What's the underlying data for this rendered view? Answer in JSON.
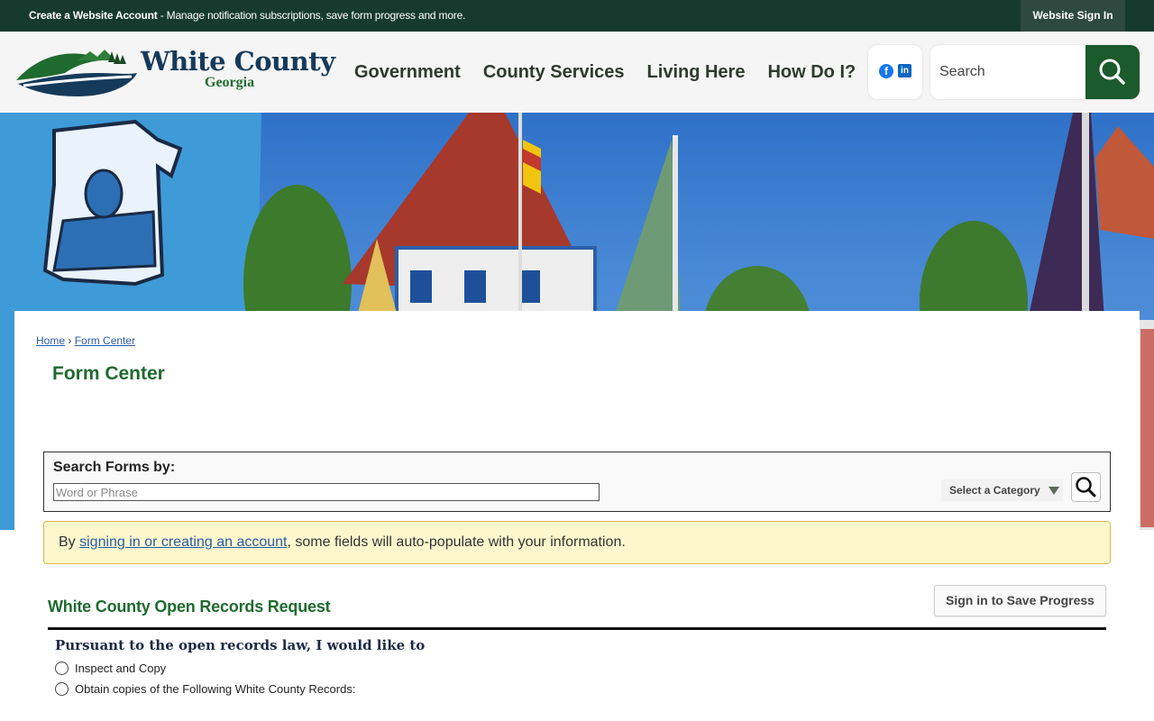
{
  "topbar": {
    "account_strong": "Create a Website Account",
    "account_rest": " - Manage notification subscriptions, save form progress and more.",
    "signin_label": "Website Sign In"
  },
  "header": {
    "logo_title": "White County",
    "logo_subtitle": "Georgia",
    "nav": [
      "Government",
      "County Services",
      "Living Here",
      "How Do I?"
    ],
    "social": {
      "facebook": "f",
      "linkedin": "in"
    },
    "search_placeholder": "Search"
  },
  "breadcrumb": {
    "home": "Home",
    "separator": "›",
    "current": "Form Center"
  },
  "page_title": "Form Center",
  "search_forms": {
    "label": "Search Forms by:",
    "placeholder": "Word or Phrase",
    "category_label": "Select a Category"
  },
  "notice": {
    "prefix": "By ",
    "link": "signing in or creating an account",
    "suffix": ", some fields will auto-populate with your information."
  },
  "form": {
    "title": "White County Open Records Request",
    "save_label": "Sign in to Save Progress",
    "question": "Pursuant to the open records law, I would like to",
    "options": [
      "Inspect and Copy",
      "Obtain copies of the Following White County Records:"
    ]
  },
  "colors": {
    "topbar": "#173a2e",
    "brand_green": "#1f6b2f",
    "search_button": "#1b5a2b",
    "link": "#2a5ca8",
    "notice_bg": "#fdf7cd"
  }
}
